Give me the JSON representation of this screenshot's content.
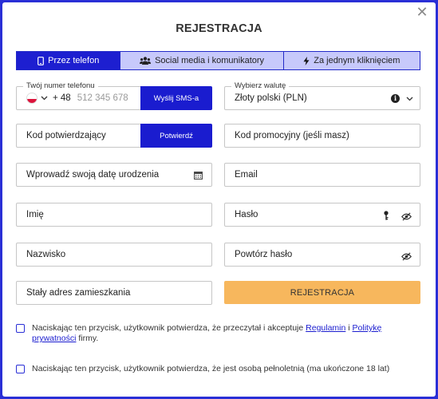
{
  "modal": {
    "title": "REJESTRACJA",
    "close_icon": "close-icon"
  },
  "tabs": [
    {
      "label": "Przez telefon",
      "icon": "phone-icon",
      "active": true
    },
    {
      "label": "Social media i komunikatory",
      "icon": "users-icon",
      "active": false
    },
    {
      "label": "Za jednym kliknięciem",
      "icon": "lightning-icon",
      "active": false
    }
  ],
  "phone": {
    "label": "Twój numer telefonu",
    "prefix": "+ 48",
    "placeholder": "512 345 678",
    "send_sms_label": "Wyślij SMS-a",
    "flag": "poland-flag-icon"
  },
  "currency": {
    "label": "Wybierz walutę",
    "value": "Złoty polski (PLN)",
    "info_icon": "info-icon"
  },
  "confirmation": {
    "placeholder": "Kod potwierdzający",
    "confirm_label": "Potwierdź"
  },
  "promo": {
    "placeholder": "Kod promocyjny (jeśli masz)"
  },
  "birthdate": {
    "placeholder": "Wprowadź swoją datę urodzenia",
    "icon": "calendar-icon"
  },
  "email": {
    "placeholder": "Email"
  },
  "first_name": {
    "placeholder": "Imię"
  },
  "password": {
    "placeholder": "Hasło",
    "key_icon": "key-icon",
    "eye_icon": "eye-slash-icon"
  },
  "last_name": {
    "placeholder": "Nazwisko"
  },
  "password_repeat": {
    "placeholder": "Powtórz hasło",
    "eye_icon": "eye-slash-icon"
  },
  "address": {
    "placeholder": "Stały adres zamieszkania"
  },
  "submit_label": "REJESTRACJA",
  "consent1": {
    "text_before": "Naciskając ten przycisk, użytkownik potwierdza, że przeczytał i akceptuje ",
    "link1": "Regulamin",
    "middle": " i ",
    "link2": "Politykę prywatności",
    "text_after": " firmy."
  },
  "consent2": {
    "text": "Naciskając ten przycisk, użytkownik potwierdza, że jest osobą pełnoletnią (ma ukończone 18 lat)"
  },
  "colors": {
    "background": "#2a2fd6",
    "primary": "#1a1ccf",
    "tab_inactive": "#c7c9fb",
    "submit": "#f7b75d"
  }
}
